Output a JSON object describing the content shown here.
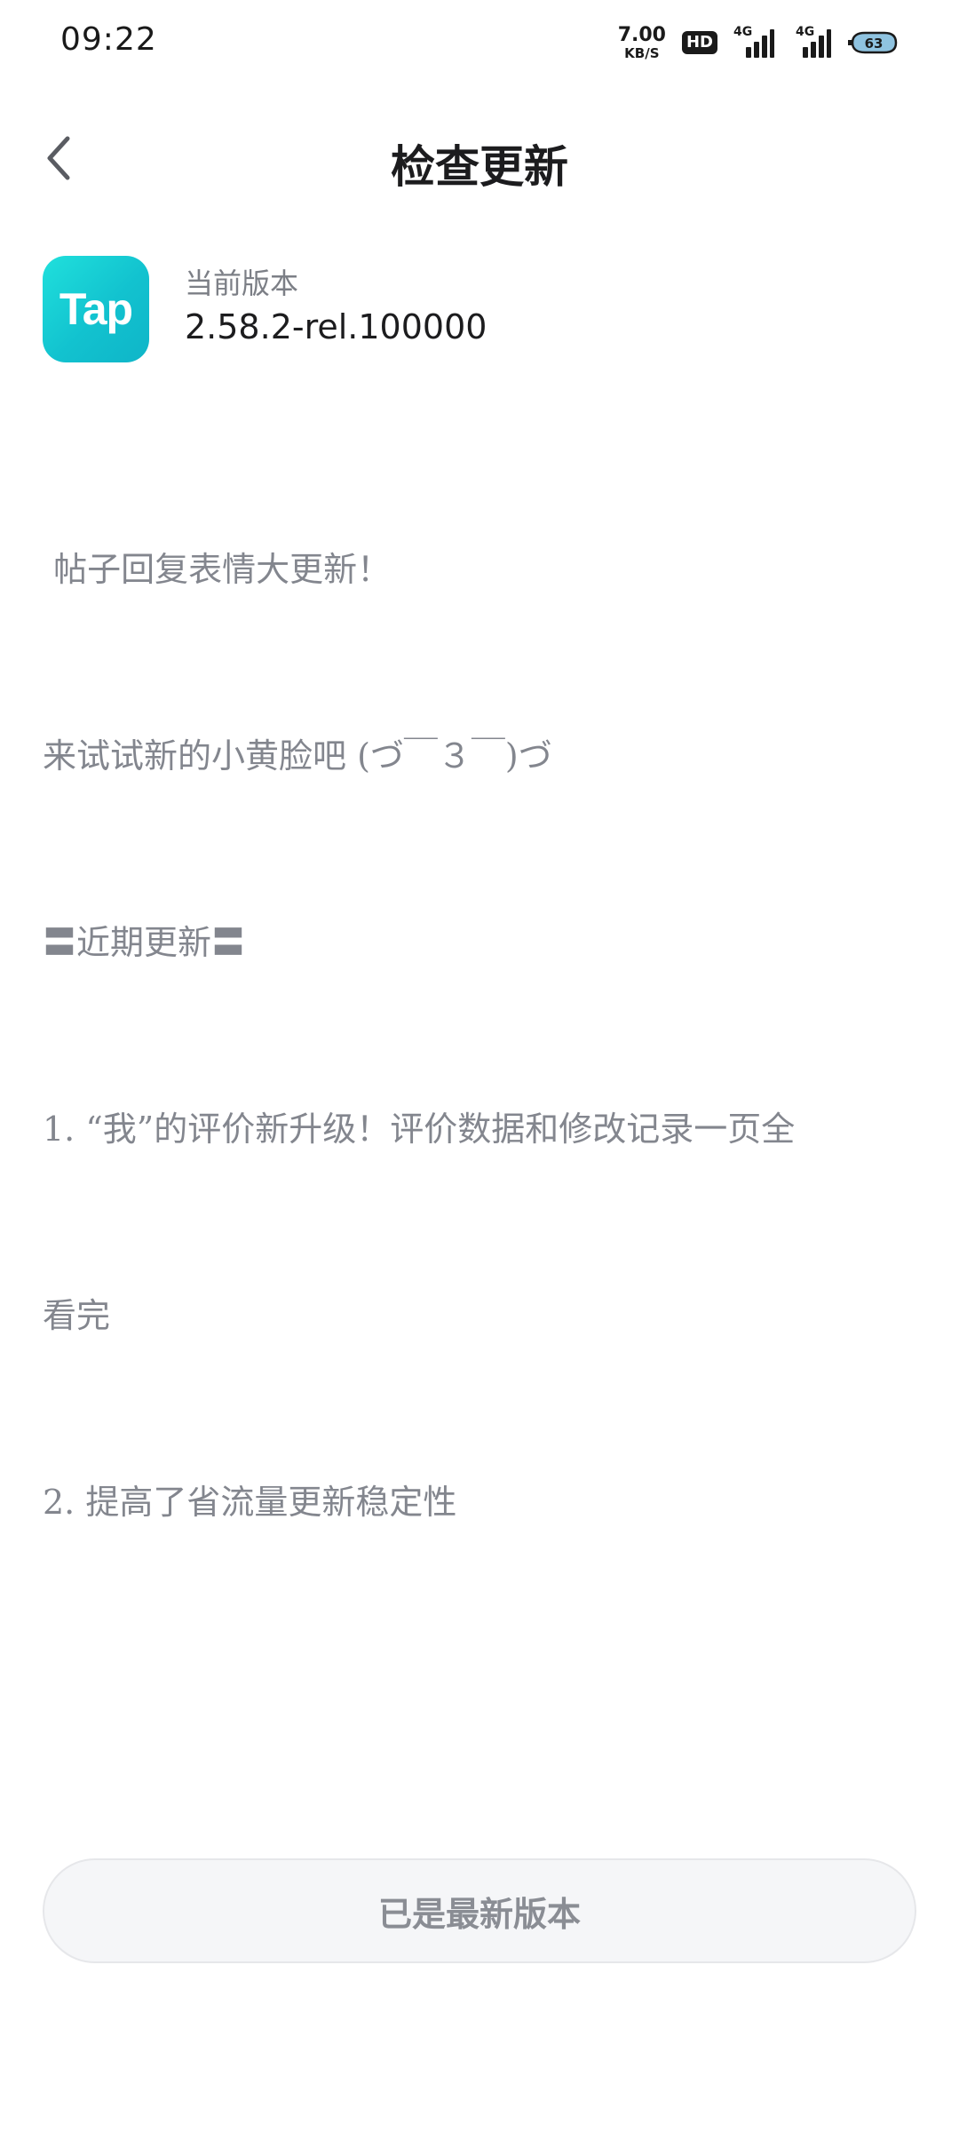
{
  "status_bar": {
    "time": "09:22",
    "net_speed_value": "7.00",
    "net_speed_unit": "KB/S",
    "hd_label": "HD",
    "signal1_label": "4G",
    "signal2_label": "4G",
    "battery_level": "63"
  },
  "header": {
    "title": "检查更新",
    "back_icon": "chevron-left-icon"
  },
  "app": {
    "logo_text": "Tap",
    "version_label": "当前版本",
    "version_value": "2.58.2-rel.100000"
  },
  "release_notes": {
    "lines": [
      " 帖子回复表情大更新！",
      "来试试新的小黄脸吧 (づ￣３￣)づ",
      "〓近期更新〓",
      "1. “我”的评价新升级！评价数据和修改记录一页全",
      "看完",
      "2. 提高了省流量更新稳定性"
    ]
  },
  "footer": {
    "button_label": "已是最新版本"
  },
  "colors": {
    "accent_logo": "#12c2cf",
    "title": "#1c1c1e",
    "muted_text": "#83868e",
    "button_bg": "#f5f6f8"
  }
}
